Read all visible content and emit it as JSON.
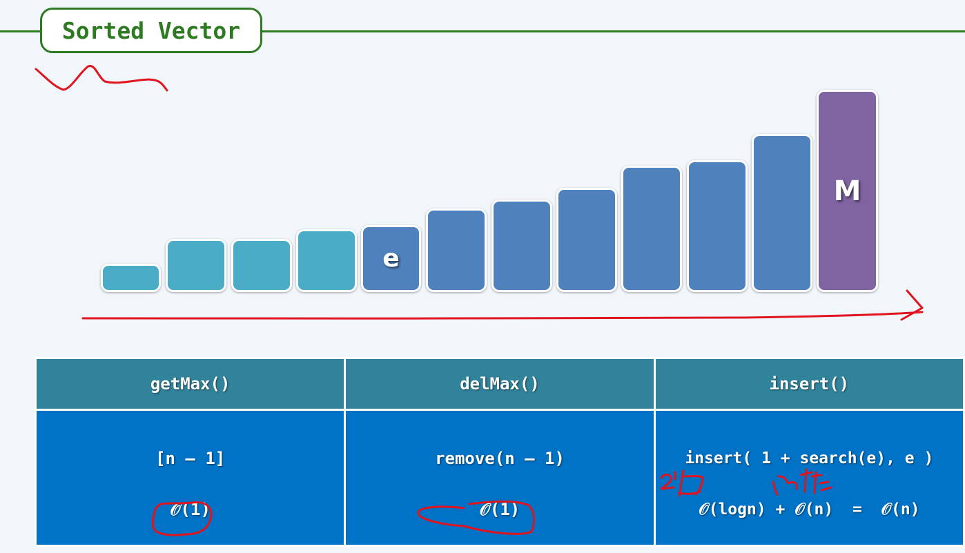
{
  "title": "Sorted Vector",
  "colors": {
    "title_green": "#2e7a22",
    "bar_teal": "#4aacc6",
    "bar_blue": "#4f81bd",
    "bar_max": "#8064a2",
    "header_bg": "#31839b",
    "cell_bg": "#0073c6",
    "annotation_red": "#e0141e"
  },
  "bars": {
    "e_label": "e",
    "max_label": "M"
  },
  "table": {
    "headers": [
      "getMax()",
      "delMax()",
      "insert()"
    ],
    "rows": [
      [
        "[n – 1]",
        "remove(n – 1)",
        "insert( 1 + search(e), e )"
      ],
      [
        "𝒪(1)",
        "𝒪(1)",
        "𝒪(logn) + 𝒪(n)  =  𝒪(n)"
      ]
    ]
  }
}
